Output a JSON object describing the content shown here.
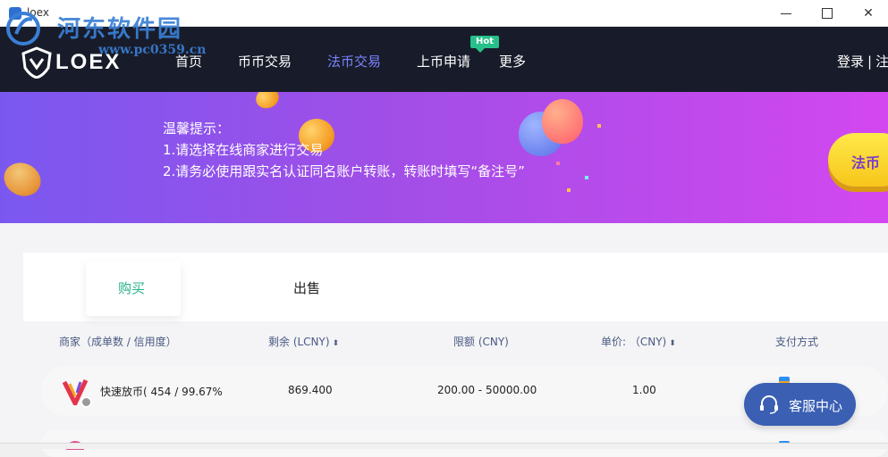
{
  "window": {
    "title": "loex",
    "minimize_icon": "minimize-icon",
    "maximize_icon": "maximize-icon",
    "close_glyph": "✕"
  },
  "watermark": {
    "text": "河东软件园",
    "url": "www.pc0359.cn"
  },
  "nav": {
    "logo_text": "LOEX",
    "items": [
      "首页",
      "币币交易",
      "法币交易",
      "上币申请",
      "更多"
    ],
    "active": "法币交易",
    "hot_badge": "Hot",
    "login": "登录",
    "separator": "|",
    "register": "注"
  },
  "banner": {
    "tips": [
      "温馨提示：",
      "1.请选择在线商家进行交易",
      "2.请务必使用跟实名认证同名账户转账，转账时填写“备注号”"
    ],
    "button_label": "法币"
  },
  "tabs": {
    "buy": "购买",
    "sell": "出售",
    "active": "购买"
  },
  "table": {
    "headers": {
      "merchant": "商家（成单数 / 信用度）",
      "remain": "剩余 (LCNY)",
      "limit": "限额 (CNY)",
      "price": "单价: （CNY)",
      "pay": "支付方式"
    },
    "sort_glyph": "⬍",
    "rows": [
      {
        "merchant": "快速放币( 454 / 99.67%",
        "remain": "869.400",
        "limit": "200.00 - 50000.00",
        "price": "1.00"
      }
    ]
  },
  "support": {
    "label": "客服中心",
    "icon": "headset-icon"
  },
  "colors": {
    "nav_bg": "#181c2a",
    "nav_active": "#7b83ff",
    "accent_green": "#27b28a",
    "hot_badge": "#27c08a",
    "support_bg": "#3a5fb3",
    "banner_start": "#7a58f0",
    "banner_end": "#d347f0"
  }
}
